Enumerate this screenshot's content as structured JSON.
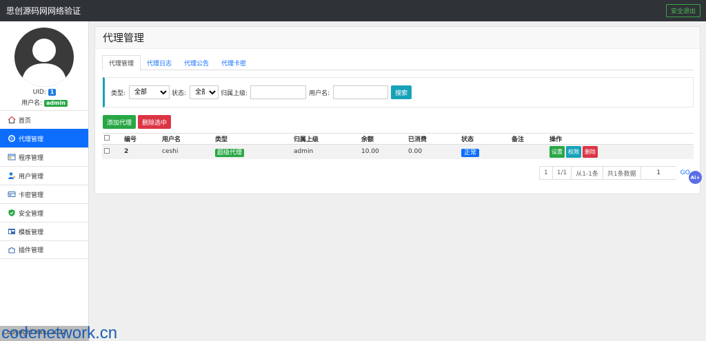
{
  "topbar": {
    "title": "思创源码网网络验证",
    "logout_label": "安全退出"
  },
  "sidebar": {
    "uid_label": "UID:",
    "uid_value": "1",
    "username_label": "用户名:",
    "username_value": "admin",
    "items": [
      {
        "label": "首页",
        "icon": "home-icon"
      },
      {
        "label": "代理管理",
        "icon": "agent-icon"
      },
      {
        "label": "程序管理",
        "icon": "program-icon"
      },
      {
        "label": "用户管理",
        "icon": "user-icon"
      },
      {
        "label": "卡密管理",
        "icon": "card-icon"
      },
      {
        "label": "安全管理",
        "icon": "shield-icon"
      },
      {
        "label": "模板管理",
        "icon": "template-icon"
      },
      {
        "label": "插件管理",
        "icon": "plugin-icon"
      }
    ],
    "footer": "Copyright Kxiu 2022",
    "watermark": "codenetwork.cn"
  },
  "panel": {
    "title": "代理管理",
    "tabs": [
      "代理管理",
      "代理日志",
      "代理公告",
      "代理卡密"
    ],
    "filter": {
      "type_label": "类型:",
      "type_value": "全部",
      "status_label": "状态:",
      "status_value": "全部",
      "parent_label": "归属上级:",
      "parent_value": "",
      "username_label": "用户名:",
      "username_value": "",
      "search_label": "搜索"
    },
    "add_label": "添加代理",
    "delete_selected_label": "删除选中",
    "columns": [
      "编号",
      "用户名",
      "类型",
      "归属上级",
      "余额",
      "已消费",
      "状态",
      "备注",
      "操作"
    ],
    "rows": [
      {
        "id": "2",
        "username": "ceshi",
        "type": "超级代理",
        "parent": "admin",
        "balance": "10.00",
        "spent": "0.00",
        "status": "正常",
        "remark": "",
        "op_settings": "设置",
        "op_perm": "权限",
        "op_delete": "删除"
      }
    ],
    "pager": {
      "page": "1",
      "of": "1/1",
      "range": "从1-1条",
      "total": "共1条数据",
      "jump_value": "1",
      "go": "GO"
    }
  },
  "fab_label": "Ai+",
  "colors": {
    "primary": "#0d6efd",
    "success": "#28a745",
    "danger": "#dc3545",
    "info": "#17a2b8",
    "topbar": "#2f3237"
  }
}
